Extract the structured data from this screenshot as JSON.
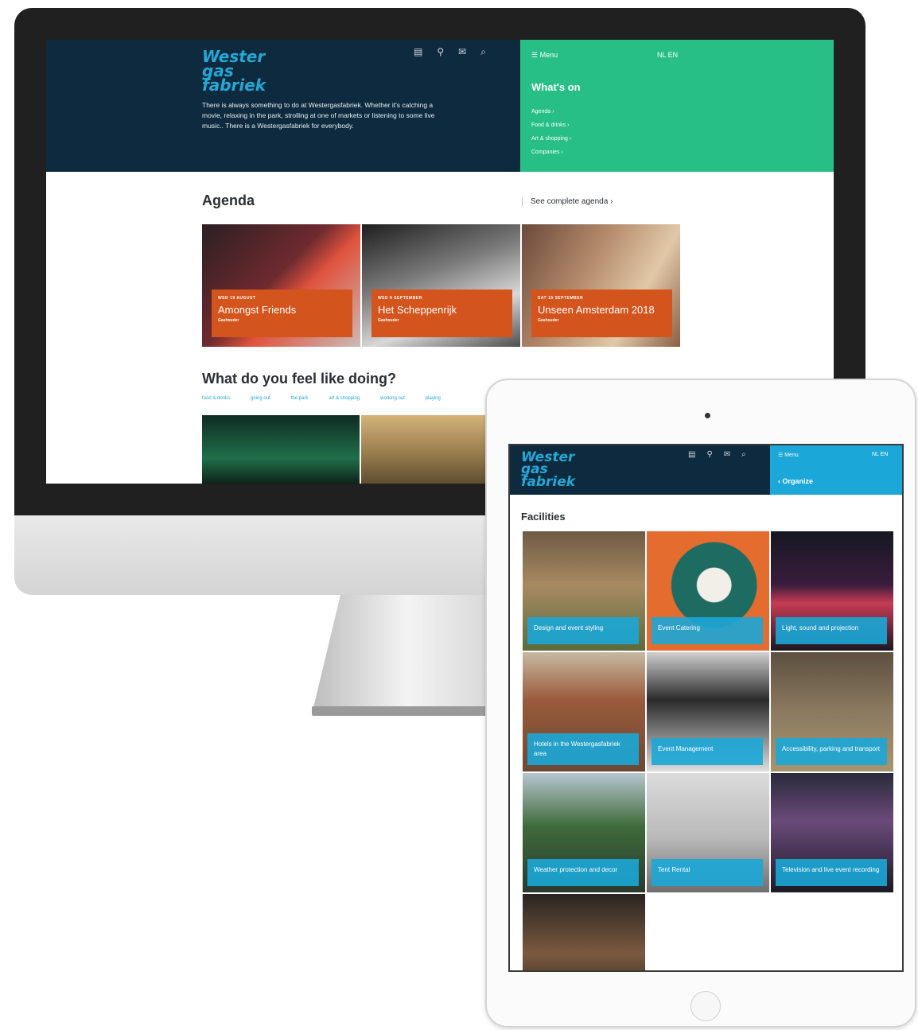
{
  "desktop": {
    "header": {
      "logo": "Wester gas fabriek",
      "intro": "There is always something to do at Westergasfabriek. Whether it's catching a movie, relaxing in the park, strolling at one of markets or listening to some live music.. There is a Westergasfabriek for everybody.",
      "icons": [
        "calendar-icon",
        "location-pin-icon",
        "mail-icon",
        "search-icon"
      ]
    },
    "panel": {
      "menu_label": "☰ Menu",
      "lang_label": "NL EN",
      "title": "What's on",
      "links": [
        "Agenda ›",
        "Food & drinks ›",
        "Art & shopping ›",
        "Companies ›"
      ],
      "color": "#27bf86"
    },
    "agenda": {
      "title": "Agenda",
      "see_all": "See complete agenda ›",
      "cards": [
        {
          "date": "WED 19 AUGUST",
          "title": "Amongst Friends",
          "venue": "Gashouder"
        },
        {
          "date": "WED 9 SEPTEMBER",
          "title": "Het Scheppenrijk",
          "venue": "Gashouder"
        },
        {
          "date": "SAT 19 SEPTEMBER",
          "title": "Unseen Amsterdam 2018",
          "venue": "Gashouder"
        }
      ]
    },
    "feel": {
      "title": "What do you feel like doing?",
      "tags": [
        "food & drinks",
        "going out",
        "the park",
        "art & shopping",
        "working out",
        "playing"
      ]
    }
  },
  "tablet": {
    "header": {
      "logo": "Wester gas fabriek",
      "menu_label": "☰ Menu",
      "lang_label": "NL EN",
      "section": "‹ Organize",
      "color": "#1ba7d7"
    },
    "facilities": {
      "title": "Facilities",
      "tiles": [
        {
          "label": "Design and event styling"
        },
        {
          "label": "Event Catering"
        },
        {
          "label": "Light, sound and projection"
        },
        {
          "label": "Hotels in the Westergasfabriek area"
        },
        {
          "label": "Event Management"
        },
        {
          "label": "Accessibility, parking and transport"
        },
        {
          "label": "Weather protection and decor"
        },
        {
          "label": "Tent Rental"
        },
        {
          "label": "Television and live event recording"
        },
        {
          "label": ""
        }
      ]
    }
  }
}
